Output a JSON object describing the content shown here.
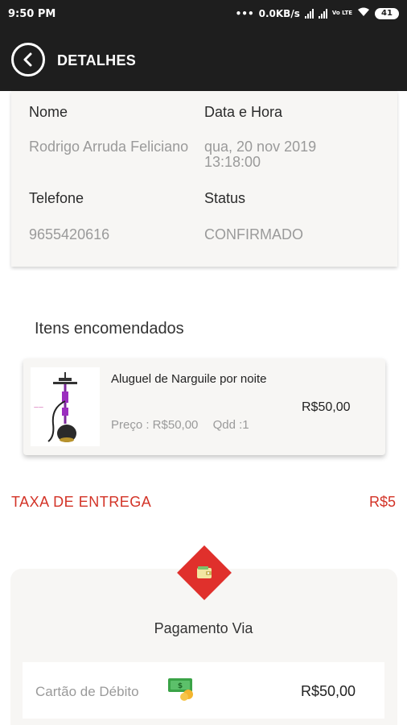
{
  "status_bar": {
    "time": "9:50 PM",
    "dots": "•••",
    "network_speed": "0.0KB/s",
    "volte": "Vo LTE",
    "battery": "41"
  },
  "header": {
    "title": "DETALHES",
    "back_icon": "chevron-left-circle-icon"
  },
  "details": {
    "name_label": "Nome",
    "name_value": "Rodrigo Arruda Feliciano",
    "date_label": "Data e Hora",
    "date_value": "qua, 20 nov 2019 13:18:00",
    "phone_label": "Telefone",
    "phone_value": "9655420616",
    "status_label": "Status",
    "status_value": "CONFIRMADO"
  },
  "items_section": {
    "title": "Itens encomendados",
    "items": [
      {
        "name": "Aluguel de Narguile por noite",
        "price_text": "Preço : R$50,00",
        "qty_text": "Qdd :1",
        "total": "R$50,00"
      }
    ]
  },
  "delivery_fee": {
    "label": "TAXA DE ENTREGA",
    "value": "R$5"
  },
  "payment": {
    "title": "Pagamento Via",
    "method": "Cartão de Débito",
    "amount": "R$50,00",
    "icon": "wallet-icon",
    "method_icon": "cash-icon"
  },
  "colors": {
    "accent": "#d33327",
    "app_bar": "#1e1e1e",
    "card_bg": "#f7f6f4"
  }
}
